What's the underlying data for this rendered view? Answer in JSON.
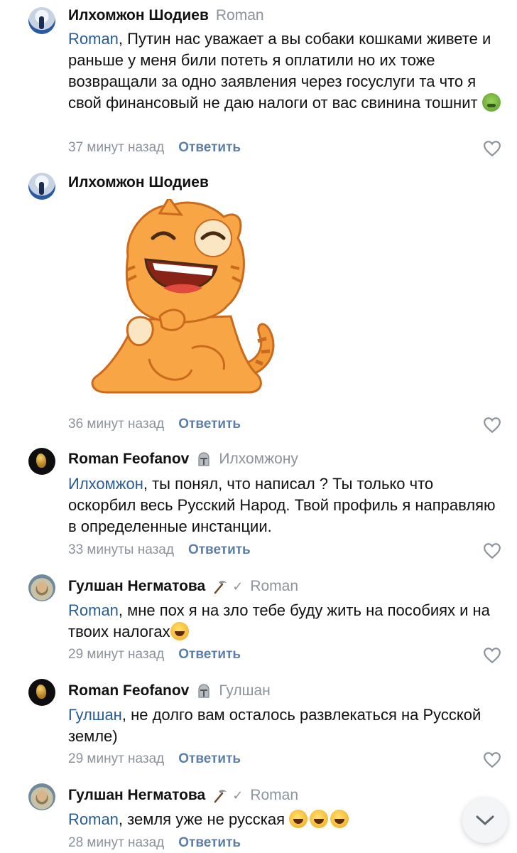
{
  "comments": [
    {
      "author": "Илхомжон Шодиев",
      "reply_to": "Roman",
      "mention": "Roman",
      "text": ", Путин нас уважает а вы собаки кошками живете и раньше у меня били потеть я оплатили но их тоже возвращали за одно заявления через госуслуги та что я свой финансовый не даю налоги от вас свинина тошнит",
      "emoji": "nauseated-face-emoji",
      "time": "37 минут назад",
      "reply_label": "Ответить"
    },
    {
      "author": "Илхомжон Шодиев",
      "sticker": "laughing-cat-sticker",
      "time": "36 минут назад",
      "reply_label": "Ответить"
    },
    {
      "author": "Roman Feofanov",
      "badge": "knight-helmet-icon",
      "reply_to": "Илхомжону",
      "mention": "Илхомжон",
      "text": ", ты понял, что написал ? Ты только что оскорбил весь Русский Народ. Твой профиль я направляю в определенные инстанции.",
      "time": "33 минуты назад",
      "reply_label": "Ответить"
    },
    {
      "author": "Гулшан Негматова",
      "badge": "pickaxe-icon",
      "reply_to": "Roman",
      "mention": "Roman",
      "text": ", мне пох я на зло тебе буду жить на пособиях и на твоих налогах",
      "emoji": "rofl-emoji",
      "time": "29 минут назад",
      "reply_label": "Ответить"
    },
    {
      "author": "Roman Feofanov",
      "badge": "knight-helmet-icon",
      "reply_to": "Гулшан",
      "mention": "Гулшан",
      "text": ", не долго вам осталось развлекаться на Русской земле)",
      "time": "29 минут назад",
      "reply_label": "Ответить"
    },
    {
      "author": "Гулшан Негматова",
      "badge": "pickaxe-icon",
      "reply_to": "Roman",
      "mention": "Roman",
      "text": ", земля уже не русская",
      "emoji": "rofl-emoji x3",
      "time": "28 минут назад",
      "reply_label": "Ответить"
    }
  ],
  "icons": {
    "like": "heart-outline-icon",
    "scroll": "chevron-down-icon"
  },
  "colors": {
    "mention": "#2a5c94",
    "reply_button": "#5d7ea6",
    "muted": "#8d939b"
  }
}
